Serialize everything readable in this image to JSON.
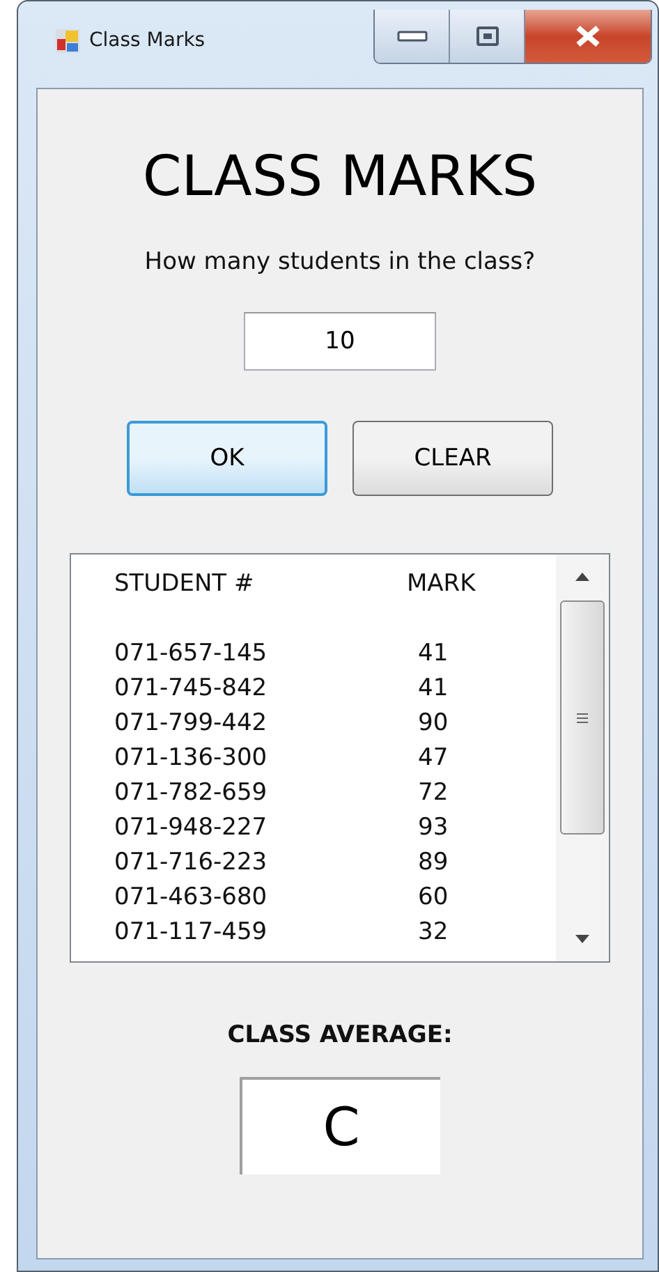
{
  "window": {
    "title": "Class Marks"
  },
  "heading": "CLASS MARKS",
  "prompt": "How many students in the class?",
  "students_field": {
    "value": "10"
  },
  "buttons": [
    {
      "label": "OK",
      "focused": true
    },
    {
      "label": "CLEAR",
      "focused": false
    }
  ],
  "list": {
    "header": {
      "student": "STUDENT #",
      "mark": "MARK"
    },
    "rows": [
      {
        "student": "071-657-145",
        "mark": "41"
      },
      {
        "student": "071-745-842",
        "mark": "41"
      },
      {
        "student": "071-799-442",
        "mark": "90"
      },
      {
        "student": "071-136-300",
        "mark": "47"
      },
      {
        "student": "071-782-659",
        "mark": "72"
      },
      {
        "student": "071-948-227",
        "mark": "93"
      },
      {
        "student": "071-716-223",
        "mark": "89"
      },
      {
        "student": "071-463-680",
        "mark": "60"
      },
      {
        "student": "071-117-459",
        "mark": "32"
      }
    ]
  },
  "average_label": "CLASS AVERAGE:",
  "average_value": "C"
}
